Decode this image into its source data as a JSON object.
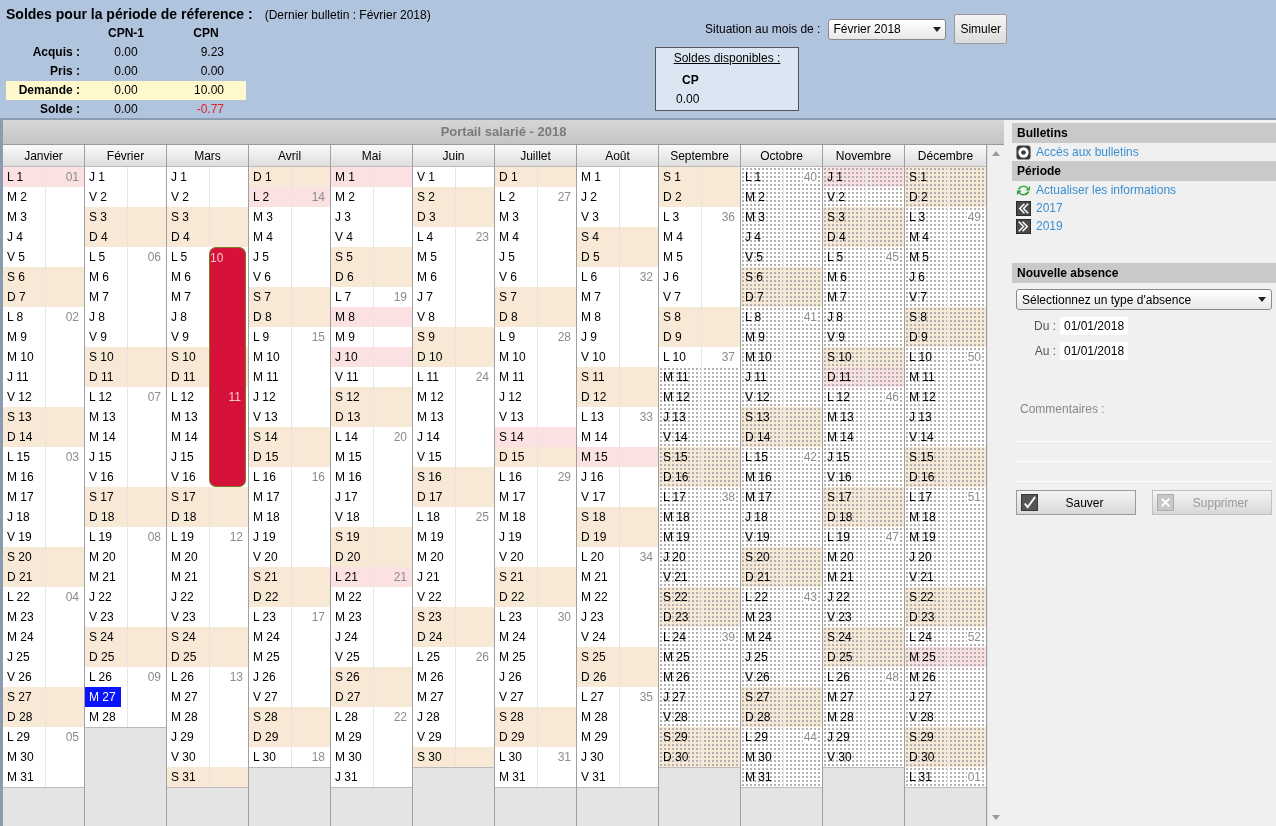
{
  "balances": {
    "title": "Soldes pour la période de réference :",
    "note": "(Dernier bulletin : Février 2018)",
    "columns": [
      "CPN-1",
      "CPN"
    ],
    "rows": [
      {
        "label": "Acquis :",
        "highlighted": false,
        "values": [
          {
            "text": "0.00",
            "negative": false
          },
          {
            "text": "9.23",
            "negative": false
          }
        ]
      },
      {
        "label": "Pris :",
        "highlighted": false,
        "values": [
          {
            "text": "0.00",
            "negative": false
          },
          {
            "text": "0.00",
            "negative": false
          }
        ]
      },
      {
        "label": "Demande :",
        "highlighted": true,
        "values": [
          {
            "text": "0.00",
            "negative": false
          },
          {
            "text": "10.00",
            "negative": false
          }
        ]
      },
      {
        "label": "Solde :",
        "highlighted": false,
        "values": [
          {
            "text": "0.00",
            "negative": false
          },
          {
            "text": "-0.77",
            "negative": true
          }
        ]
      }
    ]
  },
  "situation": {
    "label": "Situation au mois de :",
    "month": "Février 2018",
    "button": "Simuler"
  },
  "available": {
    "title": "Soldes disponibles :",
    "column": "CP",
    "value": "0.00"
  },
  "calendar": {
    "title": "Portail salarié - 2018",
    "months": [
      {
        "name": "Janvier",
        "days": [
          {
            "label": "L 1",
            "week": "01",
            "kind": "holiday"
          },
          {
            "label": "M 2",
            "kind": "work"
          },
          {
            "label": "M 3",
            "kind": "work"
          },
          {
            "label": "J 4",
            "kind": "work"
          },
          {
            "label": "V 5",
            "kind": "work"
          },
          {
            "label": "S 6",
            "kind": "weekend"
          },
          {
            "label": "D 7",
            "kind": "weekend"
          },
          {
            "label": "L 8",
            "week": "02",
            "kind": "work"
          },
          {
            "label": "M 9",
            "kind": "work"
          },
          {
            "label": "M 10",
            "kind": "work"
          },
          {
            "label": "J 11",
            "kind": "work"
          },
          {
            "label": "V 12",
            "kind": "work"
          },
          {
            "label": "S 13",
            "kind": "weekend"
          },
          {
            "label": "D 14",
            "kind": "weekend"
          },
          {
            "label": "L 15",
            "week": "03",
            "kind": "work"
          },
          {
            "label": "M 16",
            "kind": "work"
          },
          {
            "label": "M 17",
            "kind": "work"
          },
          {
            "label": "J 18",
            "kind": "work"
          },
          {
            "label": "V 19",
            "kind": "work"
          },
          {
            "label": "S 20",
            "kind": "weekend"
          },
          {
            "label": "D 21",
            "kind": "weekend"
          },
          {
            "label": "L 22",
            "week": "04",
            "kind": "work"
          },
          {
            "label": "M 23",
            "kind": "work"
          },
          {
            "label": "M 24",
            "kind": "work"
          },
          {
            "label": "J 25",
            "kind": "work"
          },
          {
            "label": "V 26",
            "kind": "work"
          },
          {
            "label": "S 27",
            "kind": "weekend"
          },
          {
            "label": "D 28",
            "kind": "weekend"
          },
          {
            "label": "L 29",
            "week": "05",
            "kind": "work"
          },
          {
            "label": "M 30",
            "kind": "work"
          },
          {
            "label": "M 31",
            "kind": "work"
          }
        ]
      },
      {
        "name": "Février",
        "days": [
          {
            "label": "J 1",
            "kind": "work"
          },
          {
            "label": "V 2",
            "kind": "work"
          },
          {
            "label": "S 3",
            "kind": "weekend"
          },
          {
            "label": "D 4",
            "kind": "weekend"
          },
          {
            "label": "L 5",
            "week": "06",
            "kind": "work"
          },
          {
            "label": "M 6",
            "kind": "work"
          },
          {
            "label": "M 7",
            "kind": "work"
          },
          {
            "label": "J 8",
            "kind": "work"
          },
          {
            "label": "V 9",
            "kind": "work"
          },
          {
            "label": "S 10",
            "kind": "weekend"
          },
          {
            "label": "D 11",
            "kind": "weekend"
          },
          {
            "label": "L 12",
            "week": "07",
            "kind": "work"
          },
          {
            "label": "M 13",
            "kind": "work"
          },
          {
            "label": "M 14",
            "kind": "work"
          },
          {
            "label": "J 15",
            "kind": "work"
          },
          {
            "label": "V 16",
            "kind": "work"
          },
          {
            "label": "S 17",
            "kind": "weekend"
          },
          {
            "label": "D 18",
            "kind": "weekend"
          },
          {
            "label": "L 19",
            "week": "08",
            "kind": "work"
          },
          {
            "label": "M 20",
            "kind": "work"
          },
          {
            "label": "M 21",
            "kind": "work"
          },
          {
            "label": "J 22",
            "kind": "work"
          },
          {
            "label": "V 23",
            "kind": "work"
          },
          {
            "label": "S 24",
            "kind": "weekend"
          },
          {
            "label": "D 25",
            "kind": "weekend"
          },
          {
            "label": "L 26",
            "week": "09",
            "kind": "work"
          },
          {
            "label": "M 27",
            "kind": "current"
          },
          {
            "label": "M 28",
            "kind": "work"
          }
        ]
      },
      {
        "name": "Mars",
        "days": [
          {
            "label": "J 1",
            "kind": "work"
          },
          {
            "label": "V 2",
            "kind": "work"
          },
          {
            "label": "S 3",
            "kind": "weekend"
          },
          {
            "label": "D 4",
            "kind": "weekend"
          },
          {
            "label": "L 5",
            "week": "10",
            "kind": "work",
            "absence": true
          },
          {
            "label": "M 6",
            "kind": "work",
            "absence": true
          },
          {
            "label": "M 7",
            "kind": "work",
            "absence": true
          },
          {
            "label": "J 8",
            "kind": "work",
            "absence": true
          },
          {
            "label": "V 9",
            "kind": "work",
            "absence": true
          },
          {
            "label": "S 10",
            "kind": "weekend",
            "absence": true
          },
          {
            "label": "D 11",
            "kind": "weekend",
            "absence": true
          },
          {
            "label": "L 12",
            "week": "11",
            "kind": "work",
            "absence": true
          },
          {
            "label": "M 13",
            "kind": "work",
            "absence": true
          },
          {
            "label": "M 14",
            "kind": "work",
            "absence": true
          },
          {
            "label": "J 15",
            "kind": "work",
            "absence": true
          },
          {
            "label": "V 16",
            "kind": "work",
            "absence": true
          },
          {
            "label": "S 17",
            "kind": "weekend"
          },
          {
            "label": "D 18",
            "kind": "weekend"
          },
          {
            "label": "L 19",
            "week": "12",
            "kind": "work"
          },
          {
            "label": "M 20",
            "kind": "work"
          },
          {
            "label": "M 21",
            "kind": "work"
          },
          {
            "label": "J 22",
            "kind": "work"
          },
          {
            "label": "V 23",
            "kind": "work"
          },
          {
            "label": "S 24",
            "kind": "weekend"
          },
          {
            "label": "D 25",
            "kind": "weekend"
          },
          {
            "label": "L 26",
            "week": "13",
            "kind": "work"
          },
          {
            "label": "M 27",
            "kind": "work"
          },
          {
            "label": "M 28",
            "kind": "work"
          },
          {
            "label": "J 29",
            "kind": "work"
          },
          {
            "label": "V 30",
            "kind": "work"
          },
          {
            "label": "S 31",
            "kind": "weekend"
          }
        ]
      },
      {
        "name": "Avril",
        "days": [
          {
            "label": "D 1",
            "kind": "weekend"
          },
          {
            "label": "L 2",
            "week": "14",
            "kind": "holiday"
          },
          {
            "label": "M 3",
            "kind": "work"
          },
          {
            "label": "M 4",
            "kind": "work"
          },
          {
            "label": "J 5",
            "kind": "work"
          },
          {
            "label": "V 6",
            "kind": "work"
          },
          {
            "label": "S 7",
            "kind": "weekend"
          },
          {
            "label": "D 8",
            "kind": "weekend"
          },
          {
            "label": "L 9",
            "week": "15",
            "kind": "work"
          },
          {
            "label": "M 10",
            "kind": "work"
          },
          {
            "label": "M 11",
            "kind": "work"
          },
          {
            "label": "J 12",
            "kind": "work"
          },
          {
            "label": "V 13",
            "kind": "work"
          },
          {
            "label": "S 14",
            "kind": "weekend"
          },
          {
            "label": "D 15",
            "kind": "weekend"
          },
          {
            "label": "L 16",
            "week": "16",
            "kind": "work"
          },
          {
            "label": "M 17",
            "kind": "work"
          },
          {
            "label": "M 18",
            "kind": "work"
          },
          {
            "label": "J 19",
            "kind": "work"
          },
          {
            "label": "V 20",
            "kind": "work"
          },
          {
            "label": "S 21",
            "kind": "weekend"
          },
          {
            "label": "D 22",
            "kind": "weekend"
          },
          {
            "label": "L 23",
            "week": "17",
            "kind": "work"
          },
          {
            "label": "M 24",
            "kind": "work"
          },
          {
            "label": "M 25",
            "kind": "work"
          },
          {
            "label": "J 26",
            "kind": "work"
          },
          {
            "label": "V 27",
            "kind": "work"
          },
          {
            "label": "S 28",
            "kind": "weekend"
          },
          {
            "label": "D 29",
            "kind": "weekend"
          },
          {
            "label": "L 30",
            "week": "18",
            "kind": "work"
          }
        ]
      },
      {
        "name": "Mai",
        "days": [
          {
            "label": "M 1",
            "kind": "holiday"
          },
          {
            "label": "M 2",
            "kind": "work"
          },
          {
            "label": "J 3",
            "kind": "work"
          },
          {
            "label": "V 4",
            "kind": "work"
          },
          {
            "label": "S 5",
            "kind": "weekend"
          },
          {
            "label": "D 6",
            "kind": "weekend"
          },
          {
            "label": "L 7",
            "week": "19",
            "kind": "work"
          },
          {
            "label": "M 8",
            "kind": "holiday"
          },
          {
            "label": "M 9",
            "kind": "work"
          },
          {
            "label": "J 10",
            "kind": "holiday"
          },
          {
            "label": "V 11",
            "kind": "work"
          },
          {
            "label": "S 12",
            "kind": "weekend"
          },
          {
            "label": "D 13",
            "kind": "weekend"
          },
          {
            "label": "L 14",
            "week": "20",
            "kind": "work"
          },
          {
            "label": "M 15",
            "kind": "work"
          },
          {
            "label": "M 16",
            "kind": "work"
          },
          {
            "label": "J 17",
            "kind": "work"
          },
          {
            "label": "V 18",
            "kind": "work"
          },
          {
            "label": "S 19",
            "kind": "weekend"
          },
          {
            "label": "D 20",
            "kind": "weekend"
          },
          {
            "label": "L 21",
            "week": "21",
            "kind": "holiday"
          },
          {
            "label": "M 22",
            "kind": "work"
          },
          {
            "label": "M 23",
            "kind": "work"
          },
          {
            "label": "J 24",
            "kind": "work"
          },
          {
            "label": "V 25",
            "kind": "work"
          },
          {
            "label": "S 26",
            "kind": "weekend"
          },
          {
            "label": "D 27",
            "kind": "weekend"
          },
          {
            "label": "L 28",
            "week": "22",
            "kind": "work"
          },
          {
            "label": "M 29",
            "kind": "work"
          },
          {
            "label": "M 30",
            "kind": "work"
          },
          {
            "label": "J 31",
            "kind": "work"
          }
        ]
      },
      {
        "name": "Juin",
        "days": [
          {
            "label": "V 1",
            "kind": "work"
          },
          {
            "label": "S 2",
            "kind": "weekend"
          },
          {
            "label": "D 3",
            "kind": "weekend"
          },
          {
            "label": "L 4",
            "week": "23",
            "kind": "work"
          },
          {
            "label": "M 5",
            "kind": "work"
          },
          {
            "label": "M 6",
            "kind": "work"
          },
          {
            "label": "J 7",
            "kind": "work"
          },
          {
            "label": "V 8",
            "kind": "work"
          },
          {
            "label": "S 9",
            "kind": "weekend"
          },
          {
            "label": "D 10",
            "kind": "weekend"
          },
          {
            "label": "L 11",
            "week": "24",
            "kind": "work"
          },
          {
            "label": "M 12",
            "kind": "work"
          },
          {
            "label": "M 13",
            "kind": "work"
          },
          {
            "label": "J 14",
            "kind": "work"
          },
          {
            "label": "V 15",
            "kind": "work"
          },
          {
            "label": "S 16",
            "kind": "weekend"
          },
          {
            "label": "D 17",
            "kind": "weekend"
          },
          {
            "label": "L 18",
            "week": "25",
            "kind": "work"
          },
          {
            "label": "M 19",
            "kind": "work"
          },
          {
            "label": "M 20",
            "kind": "work"
          },
          {
            "label": "J 21",
            "kind": "work"
          },
          {
            "label": "V 22",
            "kind": "work"
          },
          {
            "label": "S 23",
            "kind": "weekend"
          },
          {
            "label": "D 24",
            "kind": "weekend"
          },
          {
            "label": "L 25",
            "week": "26",
            "kind": "work"
          },
          {
            "label": "M 26",
            "kind": "work"
          },
          {
            "label": "M 27",
            "kind": "work"
          },
          {
            "label": "J 28",
            "kind": "work"
          },
          {
            "label": "V 29",
            "kind": "work"
          },
          {
            "label": "S 30",
            "kind": "weekend"
          }
        ]
      },
      {
        "name": "Juillet",
        "days": [
          {
            "label": "D 1",
            "kind": "weekend"
          },
          {
            "label": "L 2",
            "week": "27",
            "kind": "work"
          },
          {
            "label": "M 3",
            "kind": "work"
          },
          {
            "label": "M 4",
            "kind": "work"
          },
          {
            "label": "J 5",
            "kind": "work"
          },
          {
            "label": "V 6",
            "kind": "work"
          },
          {
            "label": "S 7",
            "kind": "weekend"
          },
          {
            "label": "D 8",
            "kind": "weekend"
          },
          {
            "label": "L 9",
            "week": "28",
            "kind": "work"
          },
          {
            "label": "M 10",
            "kind": "work"
          },
          {
            "label": "M 11",
            "kind": "work"
          },
          {
            "label": "J 12",
            "kind": "work"
          },
          {
            "label": "V 13",
            "kind": "work"
          },
          {
            "label": "S 14",
            "kind": "holiday"
          },
          {
            "label": "D 15",
            "kind": "weekend"
          },
          {
            "label": "L 16",
            "week": "29",
            "kind": "work"
          },
          {
            "label": "M 17",
            "kind": "work"
          },
          {
            "label": "M 18",
            "kind": "work"
          },
          {
            "label": "J 19",
            "kind": "work"
          },
          {
            "label": "V 20",
            "kind": "work"
          },
          {
            "label": "S 21",
            "kind": "weekend"
          },
          {
            "label": "D 22",
            "kind": "weekend"
          },
          {
            "label": "L 23",
            "week": "30",
            "kind": "work"
          },
          {
            "label": "M 24",
            "kind": "work"
          },
          {
            "label": "M 25",
            "kind": "work"
          },
          {
            "label": "J 26",
            "kind": "work"
          },
          {
            "label": "V 27",
            "kind": "work"
          },
          {
            "label": "S 28",
            "kind": "weekend"
          },
          {
            "label": "D 29",
            "kind": "weekend"
          },
          {
            "label": "L 30",
            "week": "31",
            "kind": "work"
          },
          {
            "label": "M 31",
            "kind": "work"
          }
        ]
      },
      {
        "name": "Août",
        "days": [
          {
            "label": "M 1",
            "kind": "work"
          },
          {
            "label": "J 2",
            "kind": "work"
          },
          {
            "label": "V 3",
            "kind": "work"
          },
          {
            "label": "S 4",
            "kind": "weekend"
          },
          {
            "label": "D 5",
            "kind": "weekend"
          },
          {
            "label": "L 6",
            "week": "32",
            "kind": "work"
          },
          {
            "label": "M 7",
            "kind": "work"
          },
          {
            "label": "M 8",
            "kind": "work"
          },
          {
            "label": "J 9",
            "kind": "work"
          },
          {
            "label": "V 10",
            "kind": "work"
          },
          {
            "label": "S 11",
            "kind": "weekend"
          },
          {
            "label": "D 12",
            "kind": "weekend"
          },
          {
            "label": "L 13",
            "week": "33",
            "kind": "work"
          },
          {
            "label": "M 14",
            "kind": "work"
          },
          {
            "label": "M 15",
            "kind": "holiday"
          },
          {
            "label": "J 16",
            "kind": "work"
          },
          {
            "label": "V 17",
            "kind": "work"
          },
          {
            "label": "S 18",
            "kind": "weekend"
          },
          {
            "label": "D 19",
            "kind": "weekend"
          },
          {
            "label": "L 20",
            "week": "34",
            "kind": "work"
          },
          {
            "label": "M 21",
            "kind": "work"
          },
          {
            "label": "M 22",
            "kind": "work"
          },
          {
            "label": "J 23",
            "kind": "work"
          },
          {
            "label": "V 24",
            "kind": "work"
          },
          {
            "label": "S 25",
            "kind": "weekend"
          },
          {
            "label": "D 26",
            "kind": "weekend"
          },
          {
            "label": "L 27",
            "week": "35",
            "kind": "work"
          },
          {
            "label": "M 28",
            "kind": "work"
          },
          {
            "label": "M 29",
            "kind": "work"
          },
          {
            "label": "J 30",
            "kind": "work"
          },
          {
            "label": "V 31",
            "kind": "work"
          }
        ]
      },
      {
        "name": "Septembre",
        "days": [
          {
            "label": "S 1",
            "kind": "weekend"
          },
          {
            "label": "D 2",
            "kind": "weekend"
          },
          {
            "label": "L 3",
            "week": "36",
            "kind": "work"
          },
          {
            "label": "M 4",
            "kind": "work"
          },
          {
            "label": "M 5",
            "kind": "work"
          },
          {
            "label": "J 6",
            "kind": "work"
          },
          {
            "label": "V 7",
            "kind": "work"
          },
          {
            "label": "S 8",
            "kind": "weekend"
          },
          {
            "label": "D 9",
            "kind": "weekend"
          },
          {
            "label": "L 10",
            "week": "37",
            "kind": "work"
          },
          {
            "label": "M 11",
            "kind": "work",
            "hatched": true
          },
          {
            "label": "M 12",
            "kind": "work",
            "hatched": true
          },
          {
            "label": "J 13",
            "kind": "work",
            "hatched": true
          },
          {
            "label": "V 14",
            "kind": "work",
            "hatched": true
          },
          {
            "label": "S 15",
            "kind": "weekend",
            "hatched": true
          },
          {
            "label": "D 16",
            "kind": "weekend",
            "hatched": true
          },
          {
            "label": "L 17",
            "week": "38",
            "kind": "work",
            "hatched": true
          },
          {
            "label": "M 18",
            "kind": "work",
            "hatched": true
          },
          {
            "label": "M 19",
            "kind": "work",
            "hatched": true
          },
          {
            "label": "J 20",
            "kind": "work",
            "hatched": true
          },
          {
            "label": "V 21",
            "kind": "work",
            "hatched": true
          },
          {
            "label": "S 22",
            "kind": "weekend",
            "hatched": true
          },
          {
            "label": "D 23",
            "kind": "weekend",
            "hatched": true
          },
          {
            "label": "L 24",
            "week": "39",
            "kind": "work",
            "hatched": true
          },
          {
            "label": "M 25",
            "kind": "work",
            "hatched": true
          },
          {
            "label": "M 26",
            "kind": "work",
            "hatched": true
          },
          {
            "label": "J 27",
            "kind": "work",
            "hatched": true
          },
          {
            "label": "V 28",
            "kind": "work",
            "hatched": true
          },
          {
            "label": "S 29",
            "kind": "weekend",
            "hatched": true
          },
          {
            "label": "D 30",
            "kind": "weekend",
            "hatched": true
          }
        ]
      },
      {
        "name": "Octobre",
        "days": [
          {
            "label": "L 1",
            "week": "40",
            "kind": "work",
            "hatched": true
          },
          {
            "label": "M 2",
            "kind": "work",
            "hatched": true
          },
          {
            "label": "M 3",
            "kind": "work",
            "hatched": true
          },
          {
            "label": "J 4",
            "kind": "work",
            "hatched": true
          },
          {
            "label": "V 5",
            "kind": "work",
            "hatched": true
          },
          {
            "label": "S 6",
            "kind": "weekend",
            "hatched": true
          },
          {
            "label": "D 7",
            "kind": "weekend",
            "hatched": true
          },
          {
            "label": "L 8",
            "week": "41",
            "kind": "work",
            "hatched": true
          },
          {
            "label": "M 9",
            "kind": "work",
            "hatched": true
          },
          {
            "label": "M 10",
            "kind": "work",
            "hatched": true
          },
          {
            "label": "J 11",
            "kind": "work",
            "hatched": true
          },
          {
            "label": "V 12",
            "kind": "work",
            "hatched": true
          },
          {
            "label": "S 13",
            "kind": "weekend",
            "hatched": true
          },
          {
            "label": "D 14",
            "kind": "weekend",
            "hatched": true
          },
          {
            "label": "L 15",
            "week": "42",
            "kind": "work",
            "hatched": true
          },
          {
            "label": "M 16",
            "kind": "work",
            "hatched": true
          },
          {
            "label": "M 17",
            "kind": "work",
            "hatched": true
          },
          {
            "label": "J 18",
            "kind": "work",
            "hatched": true
          },
          {
            "label": "V 19",
            "kind": "work",
            "hatched": true
          },
          {
            "label": "S 20",
            "kind": "weekend",
            "hatched": true
          },
          {
            "label": "D 21",
            "kind": "weekend",
            "hatched": true
          },
          {
            "label": "L 22",
            "week": "43",
            "kind": "work",
            "hatched": true
          },
          {
            "label": "M 23",
            "kind": "work",
            "hatched": true
          },
          {
            "label": "M 24",
            "kind": "work",
            "hatched": true
          },
          {
            "label": "J 25",
            "kind": "work",
            "hatched": true
          },
          {
            "label": "V 26",
            "kind": "work",
            "hatched": true
          },
          {
            "label": "S 27",
            "kind": "weekend",
            "hatched": true
          },
          {
            "label": "D 28",
            "kind": "weekend",
            "hatched": true
          },
          {
            "label": "L 29",
            "week": "44",
            "kind": "work",
            "hatched": true
          },
          {
            "label": "M 30",
            "kind": "work",
            "hatched": true
          },
          {
            "label": "M 31",
            "kind": "work",
            "hatched": true
          }
        ]
      },
      {
        "name": "Novembre",
        "days": [
          {
            "label": "J 1",
            "kind": "holiday",
            "hatched": true
          },
          {
            "label": "V 2",
            "kind": "work",
            "hatched": true
          },
          {
            "label": "S 3",
            "kind": "weekend",
            "hatched": true
          },
          {
            "label": "D 4",
            "kind": "weekend",
            "hatched": true
          },
          {
            "label": "L 5",
            "week": "45",
            "kind": "work",
            "hatched": true
          },
          {
            "label": "M 6",
            "kind": "work",
            "hatched": true
          },
          {
            "label": "M 7",
            "kind": "work",
            "hatched": true
          },
          {
            "label": "J 8",
            "kind": "work",
            "hatched": true
          },
          {
            "label": "V 9",
            "kind": "work",
            "hatched": true
          },
          {
            "label": "S 10",
            "kind": "weekend",
            "hatched": true
          },
          {
            "label": "D 11",
            "kind": "holiday",
            "hatched": true
          },
          {
            "label": "L 12",
            "week": "46",
            "kind": "work",
            "hatched": true
          },
          {
            "label": "M 13",
            "kind": "work",
            "hatched": true
          },
          {
            "label": "M 14",
            "kind": "work",
            "hatched": true
          },
          {
            "label": "J 15",
            "kind": "work",
            "hatched": true
          },
          {
            "label": "V 16",
            "kind": "work",
            "hatched": true
          },
          {
            "label": "S 17",
            "kind": "weekend",
            "hatched": true
          },
          {
            "label": "D 18",
            "kind": "weekend",
            "hatched": true
          },
          {
            "label": "L 19",
            "week": "47",
            "kind": "work",
            "hatched": true
          },
          {
            "label": "M 20",
            "kind": "work",
            "hatched": true
          },
          {
            "label": "M 21",
            "kind": "work",
            "hatched": true
          },
          {
            "label": "J 22",
            "kind": "work",
            "hatched": true
          },
          {
            "label": "V 23",
            "kind": "work",
            "hatched": true
          },
          {
            "label": "S 24",
            "kind": "weekend",
            "hatched": true
          },
          {
            "label": "D 25",
            "kind": "weekend",
            "hatched": true
          },
          {
            "label": "L 26",
            "week": "48",
            "kind": "work",
            "hatched": true
          },
          {
            "label": "M 27",
            "kind": "work",
            "hatched": true
          },
          {
            "label": "M 28",
            "kind": "work",
            "hatched": true
          },
          {
            "label": "J 29",
            "kind": "work",
            "hatched": true
          },
          {
            "label": "V 30",
            "kind": "work",
            "hatched": true
          }
        ]
      },
      {
        "name": "Décembre",
        "days": [
          {
            "label": "S 1",
            "kind": "weekend",
            "hatched": true
          },
          {
            "label": "D 2",
            "kind": "weekend",
            "hatched": true
          },
          {
            "label": "L 3",
            "week": "49",
            "kind": "work",
            "hatched": true
          },
          {
            "label": "M 4",
            "kind": "work",
            "hatched": true
          },
          {
            "label": "M 5",
            "kind": "work",
            "hatched": true
          },
          {
            "label": "J 6",
            "kind": "work",
            "hatched": true
          },
          {
            "label": "V 7",
            "kind": "work",
            "hatched": true
          },
          {
            "label": "S 8",
            "kind": "weekend",
            "hatched": true
          },
          {
            "label": "D 9",
            "kind": "weekend",
            "hatched": true
          },
          {
            "label": "L 10",
            "week": "50",
            "kind": "work",
            "hatched": true
          },
          {
            "label": "M 11",
            "kind": "work",
            "hatched": true
          },
          {
            "label": "M 12",
            "kind": "work",
            "hatched": true
          },
          {
            "label": "J 13",
            "kind": "work",
            "hatched": true
          },
          {
            "label": "V 14",
            "kind": "work",
            "hatched": true
          },
          {
            "label": "S 15",
            "kind": "weekend",
            "hatched": true
          },
          {
            "label": "D 16",
            "kind": "weekend",
            "hatched": true
          },
          {
            "label": "L 17",
            "week": "51",
            "kind": "work",
            "hatched": true
          },
          {
            "label": "M 18",
            "kind": "work",
            "hatched": true
          },
          {
            "label": "M 19",
            "kind": "work",
            "hatched": true
          },
          {
            "label": "J 20",
            "kind": "work",
            "hatched": true
          },
          {
            "label": "V 21",
            "kind": "work",
            "hatched": true
          },
          {
            "label": "S 22",
            "kind": "weekend",
            "hatched": true
          },
          {
            "label": "D 23",
            "kind": "weekend",
            "hatched": true
          },
          {
            "label": "L 24",
            "week": "52",
            "kind": "work",
            "hatched": true
          },
          {
            "label": "M 25",
            "kind": "holiday",
            "hatched": true
          },
          {
            "label": "M 26",
            "kind": "work",
            "hatched": true
          },
          {
            "label": "J 27",
            "kind": "work",
            "hatched": true
          },
          {
            "label": "V 28",
            "kind": "work",
            "hatched": true
          },
          {
            "label": "S 29",
            "kind": "weekend",
            "hatched": true
          },
          {
            "label": "D 30",
            "kind": "weekend",
            "hatched": true
          },
          {
            "label": "L 31",
            "week": "01",
            "kind": "work",
            "hatched": true
          }
        ]
      }
    ]
  },
  "panel": {
    "sections": [
      {
        "title": "Bulletins",
        "links": [
          {
            "kind": "eye",
            "text": "Accès aux bulletins"
          }
        ]
      },
      {
        "title": "Période",
        "links": [
          {
            "kind": "refresh",
            "text": "Actualiser les informations"
          },
          {
            "kind": "previous",
            "text": "2017"
          },
          {
            "kind": "next",
            "text": "2019"
          }
        ]
      }
    ],
    "new_absence": {
      "title": "Nouvelle absence",
      "type_select": "Sélectionnez un type d'absence",
      "from_label": "Du :",
      "from": "01/01/2018",
      "to_label": "Au :",
      "to": "01/01/2018",
      "comment_label": "Commentaires :",
      "buttons": [
        {
          "label": "Sauver",
          "kind": "check",
          "disabled": false
        },
        {
          "label": "Supprimer",
          "kind": "cross",
          "disabled": true
        }
      ]
    }
  }
}
